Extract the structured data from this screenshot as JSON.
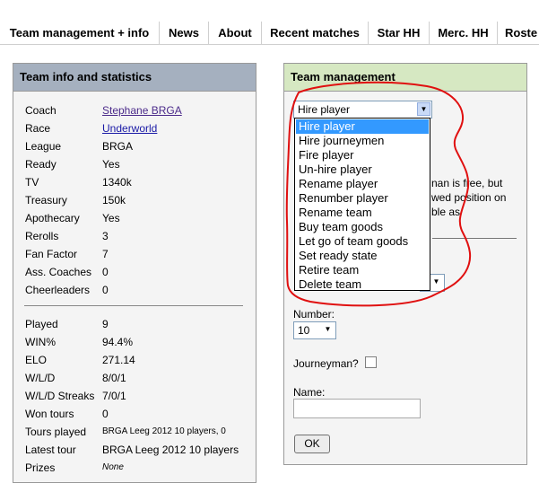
{
  "tabs": [
    "Team management + info",
    "News",
    "About",
    "Recent matches",
    "Star HH",
    "Merc. HH",
    "Roste"
  ],
  "info_panel": {
    "title": "Team info and statistics",
    "stats_top": [
      {
        "key": "Coach",
        "value": "Stephane BRGA"
      },
      {
        "key": "Race",
        "value": "Underworld"
      },
      {
        "key": "League",
        "value": "BRGA"
      },
      {
        "key": "Ready",
        "value": "Yes"
      },
      {
        "key": "TV",
        "value": "1340k"
      },
      {
        "key": "Treasury",
        "value": "150k"
      },
      {
        "key": "Apothecary",
        "value": "Yes"
      },
      {
        "key": "Rerolls",
        "value": "3"
      },
      {
        "key": "Fan Factor",
        "value": "7"
      },
      {
        "key": "Ass. Coaches",
        "value": "0"
      },
      {
        "key": "Cheerleaders",
        "value": "0"
      }
    ],
    "stats_bottom": [
      {
        "key": "Played",
        "value": "9"
      },
      {
        "key": "WIN%",
        "value": "94.4%"
      },
      {
        "key": "ELO",
        "value": "271.14"
      },
      {
        "key": "W/L/D",
        "value": "8/0/1"
      },
      {
        "key": "W/L/D Streaks",
        "value": "7/0/1"
      },
      {
        "key": "Won tours",
        "value": "0"
      },
      {
        "key": "Tours played",
        "value": "BRGA Leeg 2012 10 players, 0"
      },
      {
        "key": "Latest tour",
        "value": "BRGA Leeg 2012 10 players"
      },
      {
        "key": "Prizes",
        "value": "None"
      }
    ]
  },
  "mgmt_panel": {
    "title": "Team management",
    "action_select": {
      "selected": "Hire player",
      "options": [
        "Hire player",
        "Hire journeymen",
        "Fire player",
        "Un-hire player",
        "Rename player",
        "Renumber player",
        "Rename team",
        "Buy team goods",
        "Let go of team goods",
        "Set ready state",
        "Retire team",
        "Delete team"
      ]
    },
    "partial_text": [
      "nan is free, but",
      "wed position on",
      "ble as"
    ],
    "number_label": "Number:",
    "number_value": "10",
    "journeyman_label": "Journeyman?",
    "name_label": "Name:",
    "ok_label": "OK"
  }
}
